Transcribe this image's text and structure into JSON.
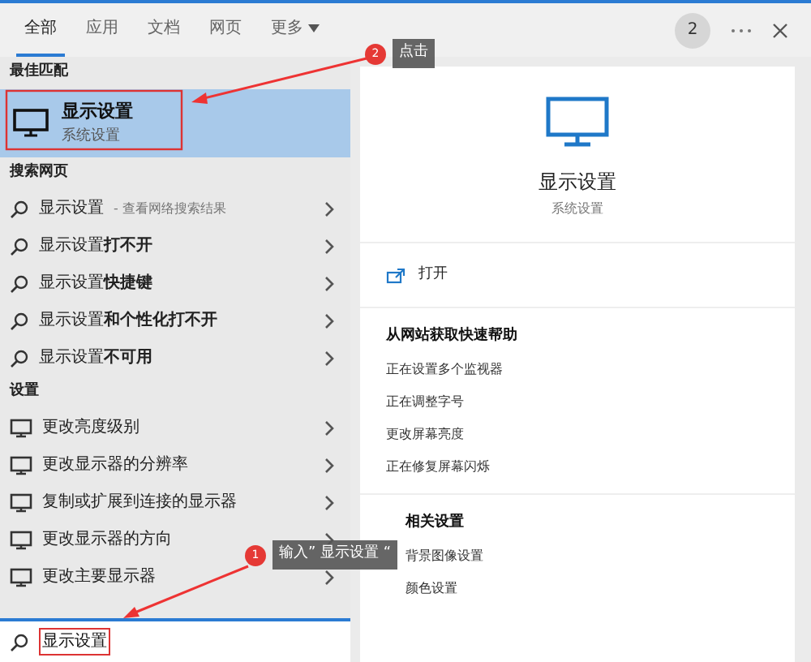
{
  "tabs": [
    {
      "label": "全部",
      "selected": true,
      "kind": "tab"
    },
    {
      "label": "应用",
      "selected": false,
      "kind": "tab"
    },
    {
      "label": "文档",
      "selected": false,
      "kind": "tab"
    },
    {
      "label": "网页",
      "selected": false,
      "kind": "tab"
    },
    {
      "label": "更多",
      "selected": false,
      "kind": "dropdown"
    }
  ],
  "header": {
    "badge": "2"
  },
  "best_match": {
    "section": "最佳匹配",
    "title": "显示设置",
    "subtitle": "系统设置",
    "selected": true
  },
  "web_section": {
    "title": "搜索网页",
    "items": [
      {
        "text": "显示设置",
        "hint": "- 查看网络搜索结果"
      },
      {
        "text": "显示设置**打不开**"
      },
      {
        "text": "显示设置**快捷键**"
      },
      {
        "text": "显示设置**和个性化打不开**"
      },
      {
        "text": "显示设置**不可用**"
      }
    ]
  },
  "settings_section": {
    "title": "设置",
    "items": [
      {
        "text": "更改亮度级别"
      },
      {
        "text": "更改显示器的分辨率"
      },
      {
        "text": "复制或扩展到连接的显示器"
      },
      {
        "text": "更改显示器的方向"
      },
      {
        "text": "更改主要显示器"
      }
    ]
  },
  "search": {
    "value": "显示设置"
  },
  "preview": {
    "title": "显示设置",
    "subtitle": "系统设置",
    "action": "打开",
    "help": {
      "title": "从网站获取快速帮助",
      "items": [
        "正在设置多个监视器",
        "正在调整字号",
        "更改屏幕亮度",
        "正在修复屏幕闪烁"
      ]
    },
    "related": {
      "title": "相关设置",
      "items": [
        "背景图像设置",
        "颜色设置"
      ]
    }
  },
  "annotations": [
    {
      "number": "2",
      "text": "点击"
    },
    {
      "number": "1",
      "text": "输入” 显示设置 “"
    }
  ]
}
